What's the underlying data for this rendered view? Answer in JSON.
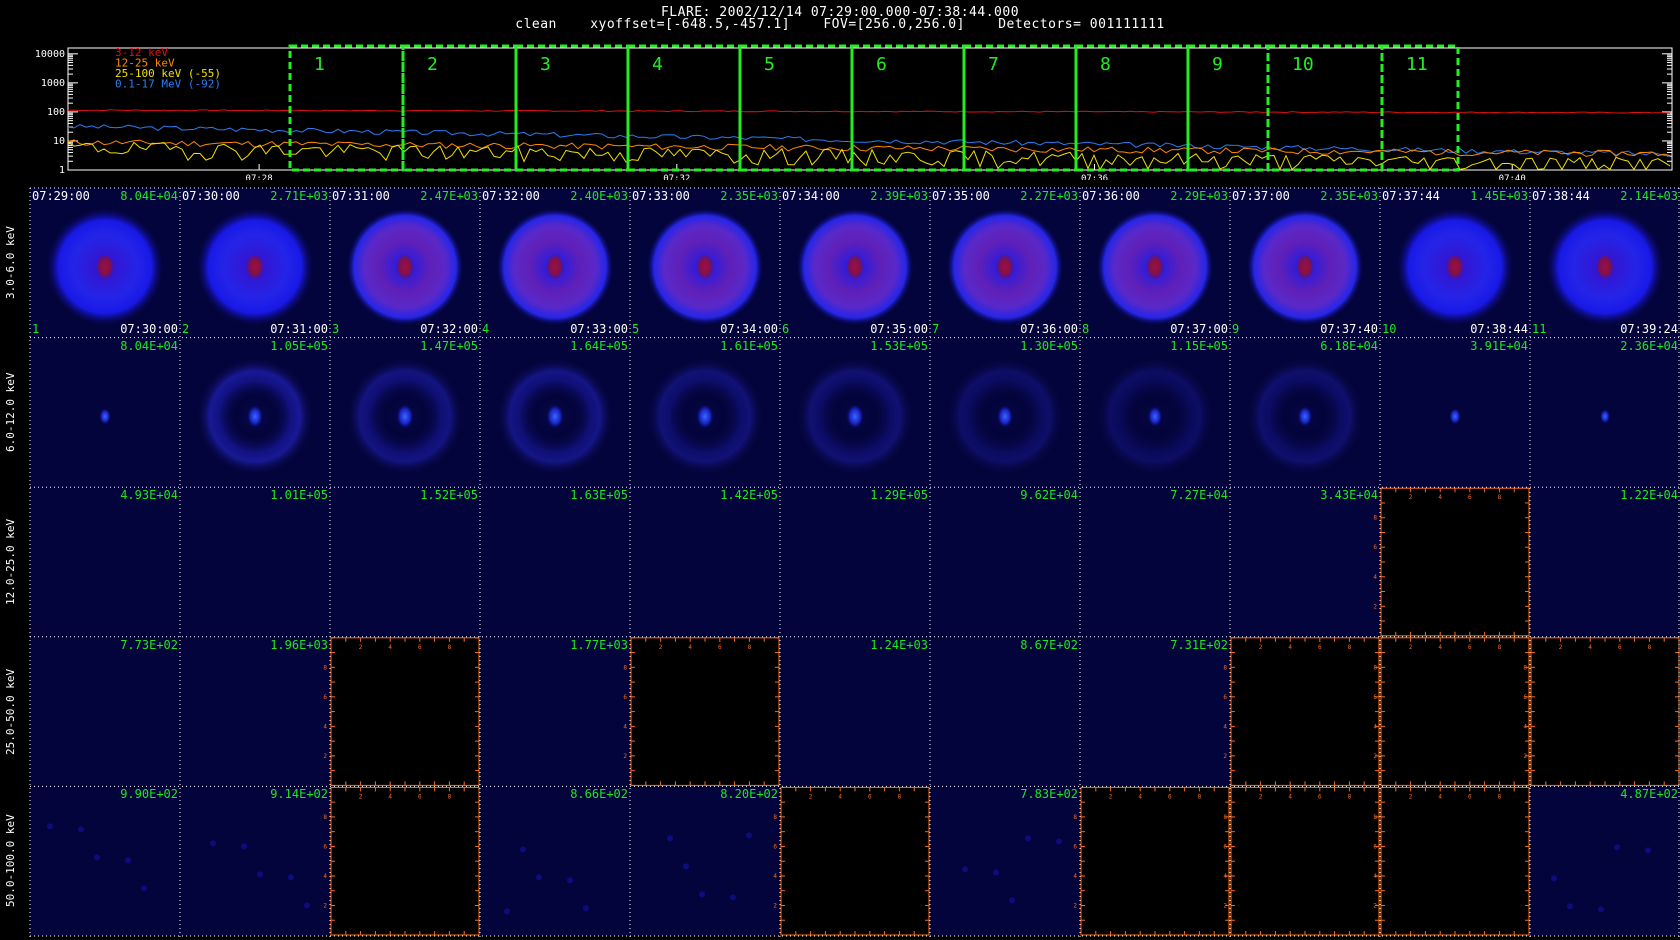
{
  "header": {
    "title": "FLARE: 2002/12/14 07:29:00.000-07:38:44.000",
    "subtitle": "clean    xyoffset=[-648.5,-457.1]    FOV=[256.0,256.0]    Detectors= 001111111"
  },
  "lightcurve": {
    "ytick_labels": [
      "10000",
      "1000",
      "100",
      "10",
      "1"
    ],
    "xtick_labels": [
      "07:28",
      "07:32",
      "07:36",
      "07:40"
    ],
    "legend": [
      {
        "text": "3-12 keV",
        "color": "#e01010"
      },
      {
        "text": "12-25 keV",
        "color": "#ff8800"
      },
      {
        "text": "25-100 keV (-55)",
        "color": "#f0e000"
      },
      {
        "text": "0.1-17 MeV (-92)",
        "color": "#2a7df5"
      }
    ],
    "interval_labels": [
      "1",
      "2",
      "3",
      "4",
      "5",
      "6",
      "7",
      "8",
      "9",
      "10",
      "11"
    ],
    "box_color": "#22ee22"
  },
  "grid": {
    "row_labels": [
      "3.0-6.0 keV",
      "6.0-12.0 keV",
      "12.0-25.0 keV",
      "25.0-50.0 keV",
      "50.0-100.0 keV"
    ],
    "first_row_start_times": [
      "07:29:00",
      "07:30:00",
      "07:31:00",
      "07:32:00",
      "07:33:00",
      "07:34:00",
      "07:35:00",
      "07:36:00",
      "07:37:00",
      "07:37:44",
      "07:38:44"
    ],
    "first_row_end_times": [
      "07:30:00",
      "07:31:00",
      "07:32:00",
      "07:33:00",
      "07:34:00",
      "07:35:00",
      "07:36:00",
      "07:37:00",
      "07:37:40",
      "07:38:44",
      "07:39:24"
    ],
    "first_row_indices": [
      "1",
      "2",
      "3",
      "4",
      "5",
      "6",
      "7",
      "8",
      "9",
      "10",
      "11"
    ],
    "values": [
      [
        "8.04E+04",
        "2.71E+03",
        "2.47E+03",
        "2.40E+03",
        "2.35E+03",
        "2.39E+03",
        "2.27E+03",
        "2.29E+03",
        "2.35E+03",
        "1.45E+03",
        "2.14E+03"
      ],
      [
        "8.04E+04",
        "1.05E+05",
        "1.47E+05",
        "1.64E+05",
        "1.61E+05",
        "1.53E+05",
        "1.30E+05",
        "1.15E+05",
        "6.18E+04",
        "3.91E+04",
        "2.36E+04"
      ],
      [
        "4.93E+04",
        "1.01E+05",
        "1.52E+05",
        "1.63E+05",
        "1.42E+05",
        "1.29E+05",
        "9.62E+04",
        "7.27E+04",
        "3.43E+04",
        "",
        "1.22E+04"
      ],
      [
        "7.73E+02",
        "1.96E+03",
        "",
        "1.77E+03",
        "",
        "1.24E+03",
        "8.67E+02",
        "7.31E+02",
        "",
        "",
        ""
      ],
      [
        "9.90E+02",
        "9.14E+02",
        "",
        "8.66E+02",
        "8.20E+02",
        "",
        "7.83E+02",
        "",
        "",
        "",
        "4.87E+02"
      ]
    ],
    "empty_axis_ticks_x": [
      "2",
      "4",
      "6",
      "8"
    ],
    "empty_axis_ticks_y": [
      "2",
      "4",
      "6",
      "8"
    ],
    "colors": {
      "cell_bg": "#04043c",
      "empty_bg": "#000000",
      "empty_axis": "#ff6a1a",
      "value_text": "#1ee81e"
    }
  }
}
